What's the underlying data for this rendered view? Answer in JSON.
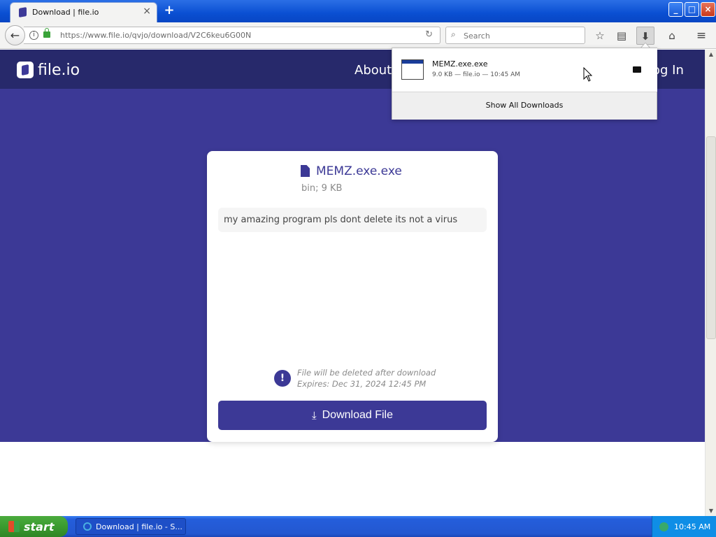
{
  "browser": {
    "tab_title": "Download | file.io",
    "tab_close": "×",
    "new_tab": "+",
    "url": "https://www.file.io/qvjo/download/V2C6keu6G00N",
    "search_placeholder": "Search",
    "window_buttons": {
      "minimize": "_",
      "maximize": "□",
      "close": "×"
    }
  },
  "site": {
    "logo_text": "file.io",
    "nav_about": "About",
    "nav_login": "og In"
  },
  "file": {
    "name": "MEMZ.exe.exe",
    "meta": "bin; 9 KB",
    "description": "my amazing program pls dont delete its not a virus",
    "warning_line1": "File will be deleted after download",
    "warning_line2": "Expires: Dec 31, 2024 12:45 PM",
    "download_label": "Download File"
  },
  "downloads_panel": {
    "item_name": "MEMZ.exe.exe",
    "item_meta": "9.0 KB — file.io — 10:45 AM",
    "show_all": "Show All Downloads"
  },
  "taskbar": {
    "start_label": "start",
    "task_label": "Download | file.io - S...",
    "clock": "10:45 AM"
  },
  "colors": {
    "brand": "#3c3996",
    "header": "#27296b"
  }
}
